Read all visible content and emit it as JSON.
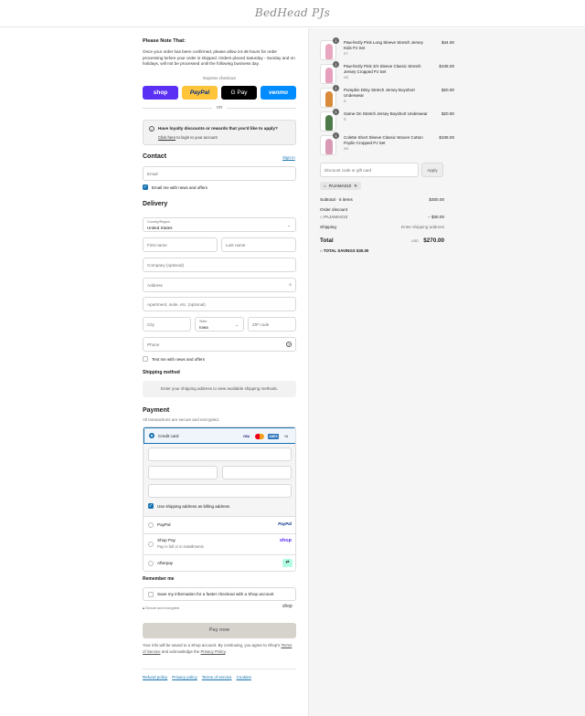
{
  "header": {
    "logo_text": "BedHead PJs"
  },
  "notice": {
    "title": "Please Note That:",
    "body": "Once your order has been confirmed, please allow 24-48 hours for order processing before your order is shipped. Orders placed Saturday - Sunday and on holidays, will not be processed until the following business day."
  },
  "express": {
    "label": "Express checkout",
    "wallets": {
      "shop": "shop",
      "paypal": "PayPal",
      "gpay": "G Pay",
      "venmo": "venmo"
    },
    "or": "OR"
  },
  "loyalty": {
    "title": "Have loyalty discounts or rewards that you'd like to apply?",
    "link": "Click here",
    "suffix": " to login to your account"
  },
  "contact": {
    "heading": "Contact",
    "sign_in": "Sign in",
    "email_placeholder": "Email",
    "newsletter_label": "Email me with news and offers",
    "newsletter_checked": true
  },
  "delivery": {
    "heading": "Delivery",
    "country_label": "Country/Region",
    "country_value": "United States",
    "first_name": "First name",
    "last_name": "Last name",
    "company": "Company (optional)",
    "address": "Address",
    "apartment": "Apartment, suite, etc. (optional)",
    "city": "City",
    "state_label": "State",
    "state_value": "Iowa",
    "zip": "ZIP code",
    "phone": "Phone",
    "sms_label": "Text me with news and offers"
  },
  "shipping": {
    "heading": "Shipping method",
    "message": "Enter your shipping address to view available shipping methods."
  },
  "payment": {
    "heading": "Payment",
    "subtitle": "All transactions are secure and encrypted.",
    "credit_card": "Credit card",
    "card_brands": {
      "visa": "VISA",
      "mc": "MC",
      "amex": "AMEX",
      "more": "+4"
    },
    "billing_label": "Use shipping address as billing address",
    "paypal": "PayPal",
    "paypal_logo": "PayPal",
    "shop_pay": "Shop Pay",
    "shop_pay_sub": "Pay in full or in installments",
    "shop_logo": "shop",
    "afterpay": "Afterpay"
  },
  "remember": {
    "heading": "Remember me",
    "label": "Save my information for a faster checkout with a Shop account",
    "secure": "Secure and encrypted",
    "shop_logo": "shop"
  },
  "pay_now": "Pay now",
  "terms": {
    "text1": "Your info will be saved to a Shop account. By continuing, you agree to Shop's ",
    "tos": "Terms of Service",
    "text2": " and acknowledge the ",
    "privacy": "Privacy Policy",
    "text3": "."
  },
  "footer": [
    "Refund policy",
    "Privacy policy",
    "Terms of service",
    "Cookies"
  ],
  "cart": {
    "items": [
      {
        "name": "Paw-fectly Pink Long Sleeve Stretch Jersey Kids PJ Set",
        "variant": "2T",
        "price": "$44.00",
        "qty": "1",
        "color": "#e8a6c0"
      },
      {
        "name": "Paw-fectly Pink 3/4 Sleeve Classic Stretch Jersey Cropped PJ Set",
        "variant": "XS",
        "price": "$108.00",
        "qty": "1",
        "color": "#e6a0bd"
      },
      {
        "name": "Pumpkin Ditsy Stretch Jersey Boyshort Underwear",
        "variant": "S",
        "price": "$20.00",
        "qty": "1",
        "color": "#d98a3a"
      },
      {
        "name": "Game On Stretch Jersey Boyshort Underwear",
        "variant": "S",
        "price": "$20.00",
        "qty": "1",
        "color": "#4e7a4a"
      },
      {
        "name": "Colette Short Sleeve Classic Woven Cotton Poplin Cropped PJ Set",
        "variant": "XS",
        "price": "$108.00",
        "qty": "1",
        "color": "#d99ab5"
      }
    ],
    "discount_placeholder": "Discount code or gift card",
    "apply": "Apply",
    "applied_code": "PAJAMAS10",
    "subtotal_label": "Subtotal · 5 items",
    "subtotal": "$300.00",
    "order_discount_label": "Order discount",
    "order_discount_code": "PAJAMAS10",
    "order_discount": "− $30.00",
    "shipping_label": "Shipping",
    "shipping_value": "Enter shipping address",
    "total_label": "Total",
    "currency": "USD",
    "total": "$270.00",
    "savings_label": "TOTAL SAVINGS",
    "savings": "$30.00"
  }
}
